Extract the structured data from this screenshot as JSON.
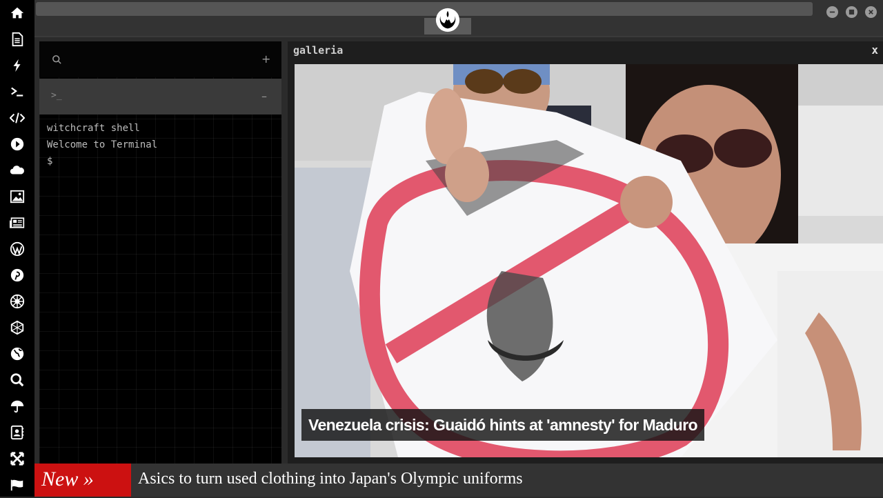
{
  "dock": {
    "icons": [
      "home-icon",
      "document-icon",
      "bolt-icon",
      "terminal-icon",
      "code-icon",
      "play-icon",
      "cloud-icon",
      "image-icon",
      "newspaper-icon",
      "wordpress-icon",
      "pinterest-icon",
      "settings-wheel-icon",
      "network-icon",
      "globe-icon",
      "search-icon",
      "umbrella-icon",
      "contacts-icon",
      "expand-icon",
      "flag-icon"
    ]
  },
  "topbar": {
    "logo": "rebel-alliance-logo",
    "window_controls": [
      "minimize-icon",
      "maximize-icon",
      "close-icon"
    ]
  },
  "terminal": {
    "search_plus": "+",
    "tab_prompt": ">_",
    "tab_minus": "–",
    "lines": [
      "witchcraft shell",
      "Welcome to Terminal",
      "$"
    ]
  },
  "galleria": {
    "title": "galleria",
    "close": "x",
    "caption": "Venezuela crisis: Guaidó hints at 'amnesty' for Maduro"
  },
  "ticker": {
    "badge": "New »",
    "headline": "Asics to turn used clothing into Japan's Olympic uniforms"
  },
  "colors": {
    "dock": "#000000",
    "panel": "#333333",
    "badge": "#cc1111"
  }
}
